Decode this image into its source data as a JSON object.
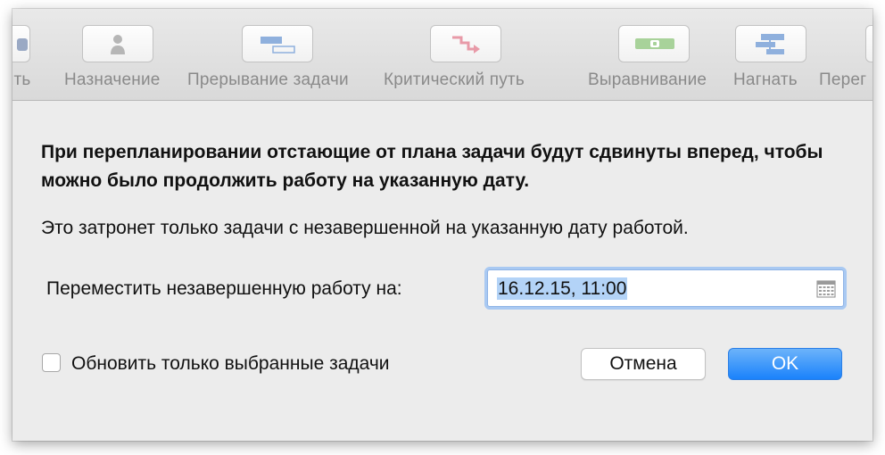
{
  "toolbar": {
    "items": [
      {
        "label": "нить",
        "icon": "partial-icon"
      },
      {
        "label": "Назначение",
        "icon": "person-icon"
      },
      {
        "label": "Прерывание задачи",
        "icon": "split-task-icon"
      },
      {
        "label": "Критический путь",
        "icon": "critical-path-icon"
      },
      {
        "label": "Выравнивание",
        "icon": "level-icon"
      },
      {
        "label": "Нагнать",
        "icon": "catch-up-icon"
      },
      {
        "label": "Перег",
        "icon": "partial-icon"
      }
    ]
  },
  "dialog": {
    "headline": "При перепланировании отстающие от плана задачи будут сдвинуты вперед, чтобы можно было продолжить работу на указанную дату.",
    "info": "Это затронет только задачи с незавершенной на указанную дату работой.",
    "move_label": "Переместить незавершенную работу на:",
    "date_value": "16.12.15, 11:00",
    "checkbox_label": "Обновить только выбранные задачи",
    "checkbox_checked": false,
    "cancel_label": "Отмена",
    "ok_label": "OK"
  },
  "colors": {
    "accent": "#1a82fb",
    "field_focus": "#a9c9f2",
    "selection": "#b3d3f7"
  }
}
